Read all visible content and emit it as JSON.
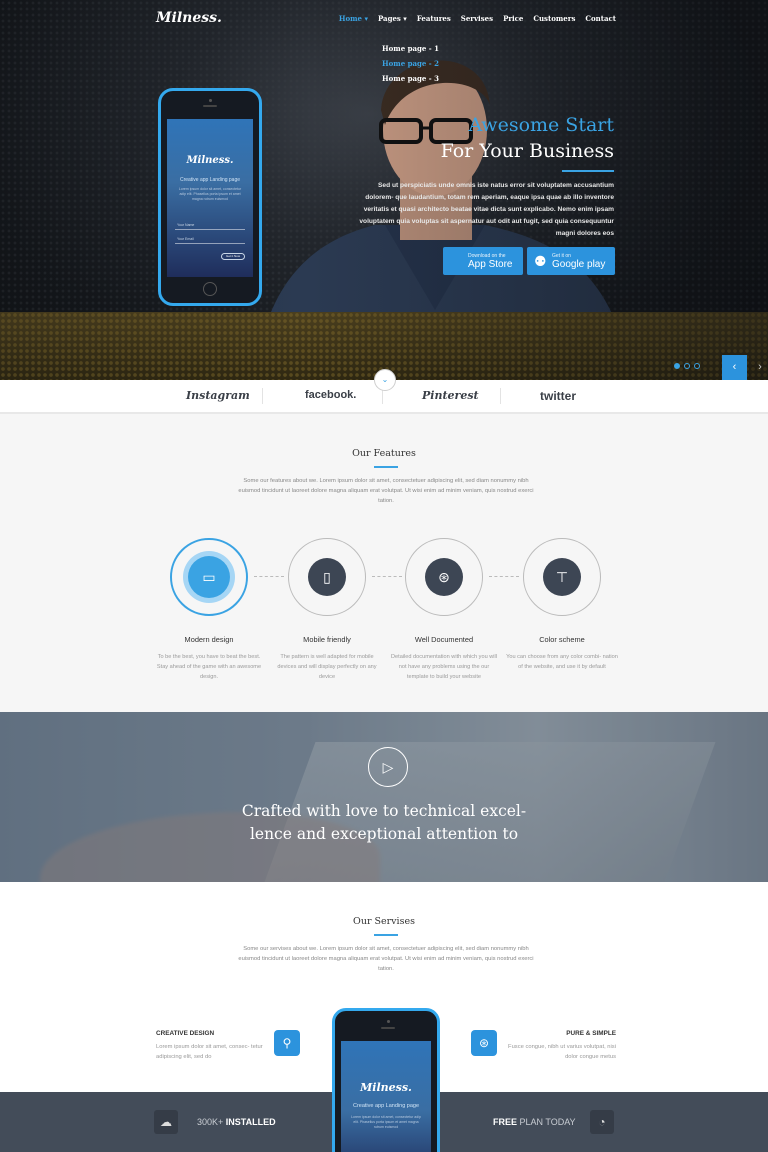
{
  "brand": {
    "logo": "Milness."
  },
  "nav": {
    "items": [
      "Home ▾",
      "Pages ▾",
      "Features",
      "Servises",
      "Price",
      "Customers",
      "Contact"
    ],
    "submenu": [
      "Home page - 1",
      "Home page - 2",
      "Home page - 3"
    ]
  },
  "hero": {
    "title_accent": "Awesome Start",
    "title": "For Your Business",
    "text": "Sed ut perspiciatis unde omnis iste natus error sit voluptatem accusantium dolorem- que laudantium, totam rem aperiam, eaque ipsa quae ab illo inventore veritatis et quasi architecto beatae vitae dicta sunt explicabo. Nemo enim ipsam voluptatem quia voluptas sit aspernatur aut odit aut fugit, sed quia consequuntur magni dolores eos",
    "appstore": {
      "small": "Download on the",
      "label": "App Store"
    },
    "googleplay": {
      "small": "Get it on",
      "label": "Google play"
    },
    "slider": {
      "count": 3,
      "active": 1,
      "prev": "‹",
      "next": "›"
    }
  },
  "phone_screen": {
    "logo": "Milness.",
    "subtitle": "Creative app Landing page",
    "text": "Lorem ipsum dolor sit amet, consectetur adip elit. Phasellus porta ipsum et amet magna rutrum euismod",
    "name_label": "Your Name",
    "email_label": "Your Email",
    "button": "Get it Now"
  },
  "social": {
    "scroll_icon": "⌄",
    "brands": [
      "Instagram",
      "facebook.",
      "Pinterest",
      "twitter"
    ]
  },
  "features": {
    "title": "Our Features",
    "text": "Some our features about we. Lorem ipsum dolor sit amet, consectetuer adipiscing elit, sed diam nonummy nibh euismod tincidunt ut laoreet dolore magna aliquam erat volutpat. Ut wisi enim ad minim veniam, quis nostrud exerci tation.",
    "items": [
      {
        "title": "Modern design",
        "icon": "browser-window-icon",
        "glyph": "▭",
        "desc": "To be the best, you have to beat the best. Stay ahead of the game with an awesome design."
      },
      {
        "title": "Mobile friendly",
        "icon": "mobile-icon",
        "glyph": "▯",
        "desc": "The pattern is well adapted for mobile devices and will display perfectly on any device"
      },
      {
        "title": "Well Documented",
        "icon": "lifebuoy-icon",
        "glyph": "⊛",
        "desc": "Detailed documentation with which you will not have any problems using the our template to build your website"
      },
      {
        "title": "Color scheme",
        "icon": "paint-roller-icon",
        "glyph": "⊤",
        "desc": "You can choose from any color combi- nation of the website, and use it by default"
      }
    ]
  },
  "video": {
    "play_icon": "▷",
    "text": "Crafted with love to technical excel- lence and exceptional attention to"
  },
  "services": {
    "title": "Our Servises",
    "text": "Some our servises about we. Lorem ipsum dolor sit amet, consectetuer adipiscing elit, sed diam nonummy nibh euismod tincidunt ut laoreet dolore magna aliquam erat volutpat. Ut wisi enim ad minim veniam, quis nostrud exerci tation.",
    "left": {
      "title": "CREATIVE DESIGN",
      "text": "Lorem ipsum dolor sit amet, consec- tetur adipiscing elit, sed do",
      "icon": "bicycle-icon",
      "glyph": "⚲"
    },
    "right": {
      "title": "PURE & SIMPLE",
      "text": "Fusce congue, nibh ut varius volutpat, nisi dolor congue metus",
      "icon": "lifebuoy-icon",
      "glyph": "⊛"
    }
  },
  "stats": {
    "installed_num": "300K+",
    "installed_label": "INSTALLED",
    "free_label": "FREE",
    "plan_label": "PLAN TODAY",
    "left_icon": "cloud-download-icon",
    "right_icon": "piggy-bank-icon"
  },
  "colors": {
    "accent": "#3aa3e3",
    "button": "#2c93dd",
    "dark_bar": "#434c59"
  }
}
